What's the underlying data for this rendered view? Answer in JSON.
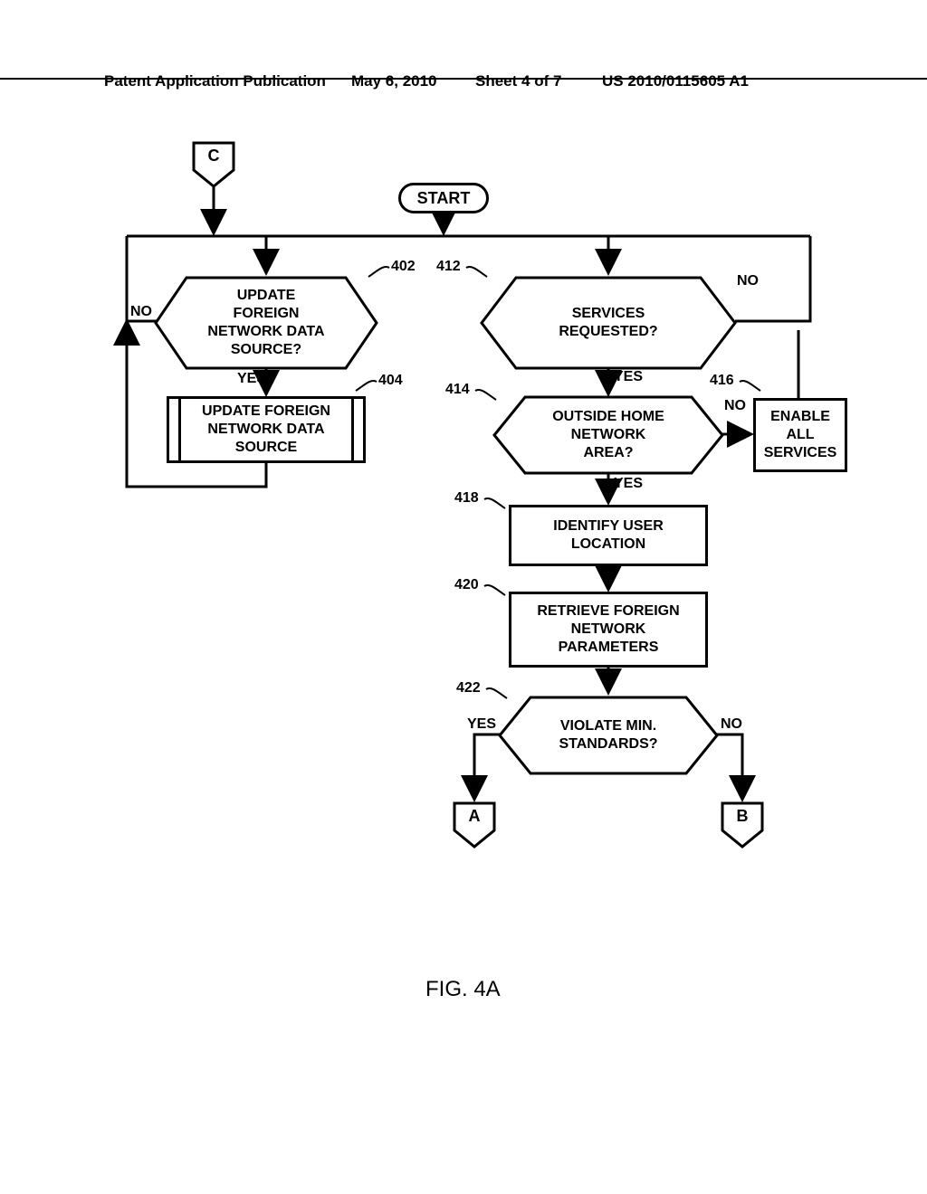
{
  "header": {
    "pub": "Patent Application Publication",
    "date": "May 6, 2010",
    "sheet": "Sheet 4 of 7",
    "pubno": "US 2010/0115605 A1"
  },
  "terminator": {
    "start": "START"
  },
  "connectors": {
    "c": "C",
    "a": "A",
    "b": "B"
  },
  "decisions": {
    "d402": "UPDATE\nFOREIGN\nNETWORK DATA\nSOURCE?",
    "d412": "SERVICES\nREQUESTED?",
    "d414": "OUTSIDE HOME\nNETWORK\nAREA?",
    "d422": "VIOLATE MIN.\nSTANDARDS?"
  },
  "processes": {
    "p404": "UPDATE FOREIGN\nNETWORK DATA\nSOURCE",
    "p416": "ENABLE\nALL\nSERVICES",
    "p418": "IDENTIFY USER\nLOCATION",
    "p420": "RETRIEVE FOREIGN\nNETWORK\nPARAMETERS"
  },
  "labels": {
    "yes": "YES",
    "no": "NO",
    "r402": "402",
    "r404": "404",
    "r412": "412",
    "r414": "414",
    "r416": "416",
    "r418": "418",
    "r420": "420",
    "r422": "422"
  },
  "figure": "FIG. 4A"
}
